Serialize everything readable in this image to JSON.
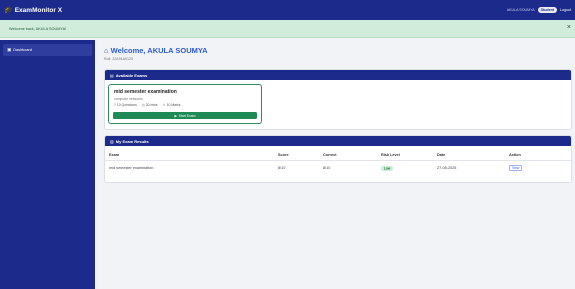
{
  "navbar": {
    "brand_icon": "graduation-cap-icon",
    "brand": "ExamMonitor X",
    "user_text": "AKULA SOUMYA",
    "badge": "Student",
    "logout": "Logout"
  },
  "flash": {
    "message": "Welcome back, AKULA SOUMYA!",
    "close": "×"
  },
  "sidebar": {
    "items": [
      {
        "icon": "dashboard-icon",
        "label": "Dashboard"
      }
    ]
  },
  "main": {
    "welcome_icon": "house-icon",
    "welcome": "Welcome, AKULA SOUMYA",
    "roll": "Roll: 22A91A0125"
  },
  "available_exams": {
    "header": "Available Exams",
    "exams": [
      {
        "title": "mid semester examination",
        "subtitle": "computer networks",
        "questions": "10 Questions",
        "duration": "30 mins",
        "marks": "10 Marks",
        "start_label": "Start Exam"
      }
    ]
  },
  "results": {
    "header": "My Exam Results",
    "columns": [
      "Exam",
      "Score",
      "Correct",
      "Risk Level",
      "Date",
      "Action"
    ],
    "rows": [
      {
        "exam": "mid semester examination",
        "score": "8/10",
        "correct": "8/10",
        "risk": "Low",
        "date": "27-08-2025",
        "action": "View"
      }
    ]
  },
  "colors": {
    "primary": "#1c2a8c",
    "accent": "#2a5bd7",
    "success": "#1f8a55",
    "flash_bg": "#d1ecdb"
  }
}
